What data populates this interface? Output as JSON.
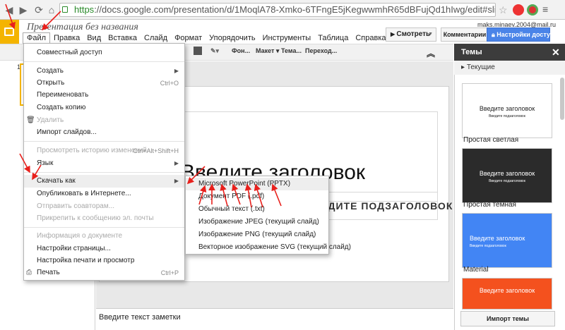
{
  "browser": {
    "url_scheme": "https",
    "url_rest": "://docs.google.com/presentation/d/1MoqlA78-Xmko-6TFngE5jKegwwmhR65dBFujQd1hIwg/edit#slide=id.p"
  },
  "doc": {
    "title": "Презентация без названия",
    "account": "maks.minaev.2004@mail.ru"
  },
  "menubar": [
    "Файл",
    "Правка",
    "Вид",
    "Вставка",
    "Слайд",
    "Формат",
    "Упорядочить",
    "Инструменты",
    "Таблица",
    "Справка"
  ],
  "header_buttons": {
    "view": "Смотреть",
    "comments": "Комментарии",
    "share": "Настройки доступа"
  },
  "toolbar": {
    "background": "Фон...",
    "layout": "Макет",
    "theme": "Тема...",
    "transition": "Переход..."
  },
  "filmstrip": {
    "slide_number": "1"
  },
  "slide": {
    "title": "Введите заголовок",
    "subtitle": "ВВЕДИТЕ ПОДЗАГОЛОВОК"
  },
  "notes": {
    "placeholder": "Введите текст заметки"
  },
  "file_menu": {
    "items": [
      {
        "label": "Совместный доступ",
        "shortcut": "",
        "submenu": false,
        "disabled": false
      },
      {
        "label": "Создать",
        "shortcut": "",
        "submenu": true,
        "disabled": false
      },
      {
        "label": "Открыть",
        "shortcut": "Ctrl+O",
        "submenu": false,
        "disabled": false
      },
      {
        "label": "Переименовать",
        "shortcut": "",
        "submenu": false,
        "disabled": false
      },
      {
        "label": "Создать копию",
        "shortcut": "",
        "submenu": false,
        "disabled": false
      },
      {
        "label": "Удалить",
        "shortcut": "",
        "submenu": false,
        "disabled": true
      },
      {
        "label": "Импорт слайдов...",
        "shortcut": "",
        "submenu": false,
        "disabled": false
      },
      {
        "label": "Просмотреть историю изменений",
        "shortcut": "Ctrl+Alt+Shift+H",
        "submenu": false,
        "disabled": true
      },
      {
        "label": "Язык",
        "shortcut": "",
        "submenu": true,
        "disabled": false
      },
      {
        "label": "Скачать как",
        "shortcut": "",
        "submenu": true,
        "disabled": false
      },
      {
        "label": "Опубликовать в Интернете...",
        "shortcut": "",
        "submenu": false,
        "disabled": false
      },
      {
        "label": "Отправить соавторам...",
        "shortcut": "",
        "submenu": false,
        "disabled": true
      },
      {
        "label": "Прикрепить к сообщению эл. почты",
        "shortcut": "",
        "submenu": false,
        "disabled": true
      },
      {
        "label": "Информация о документе",
        "shortcut": "",
        "submenu": false,
        "disabled": true
      },
      {
        "label": "Настройки страницы...",
        "shortcut": "",
        "submenu": false,
        "disabled": false
      },
      {
        "label": "Настройка печати и просмотр",
        "shortcut": "",
        "submenu": false,
        "disabled": false
      },
      {
        "label": "Печать",
        "shortcut": "Ctrl+P",
        "submenu": false,
        "disabled": false
      }
    ]
  },
  "download_submenu": {
    "items": [
      "Microsoft PowerPoint (PPTX)",
      "Документ PDF (.pdf)",
      "Обычный текст (.txt)",
      "Изображение JPEG (текущий слайд)",
      "Изображение PNG (текущий слайд)",
      "Векторное изображение SVG (текущий слайд)"
    ]
  },
  "themes_panel": {
    "header": "Темы",
    "current_label": "Текущие",
    "placeholder_title": "Введите заголовок",
    "placeholder_subtitle": "Введите подзаголовок",
    "themes": [
      {
        "name": "Простая светлая",
        "bg": "#ffffff",
        "fg": "#222222"
      },
      {
        "name": "Простая темная",
        "bg": "#2b2b2b",
        "fg": "#ffffff"
      },
      {
        "name": "Material",
        "bg": "#4285f4",
        "fg": "#ffffff"
      },
      {
        "name": "",
        "bg": "#f4511e",
        "fg": "#ffffff"
      }
    ],
    "import_button": "Импорт темы"
  },
  "colors": {
    "accent_slides": "#f4b400",
    "share_blue": "#4a84e8",
    "annotation_red": "#e8201c"
  }
}
